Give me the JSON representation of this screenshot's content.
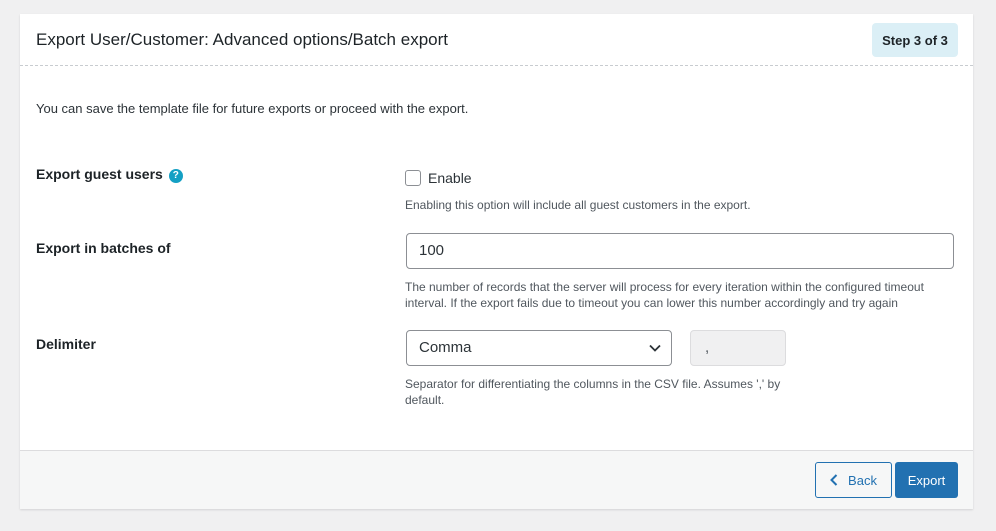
{
  "header": {
    "title": "Export User/Customer: Advanced options/Batch export",
    "step_badge": "Step 3 of 3"
  },
  "intro": "You can save the template file for future exports or proceed with the export.",
  "guest_users": {
    "label": "Export guest users",
    "help_icon": "question-circle-icon",
    "checkbox_label": "Enable",
    "checked": false,
    "description": "Enabling this option will include all guest customers in the export."
  },
  "batches": {
    "label": "Export in batches of",
    "value": "100",
    "description_line1": "The number of records that the server will process for every iteration within the configured timeout",
    "description_line2": "interval. If the export fails due to timeout you can lower this number accordingly and try again"
  },
  "delimiter": {
    "label": "Delimiter",
    "selected": "Comma",
    "value": ",",
    "description_line1": "Separator for differentiating the columns in the CSV file. Assumes ',' by",
    "description_line2": "default."
  },
  "footer": {
    "back_label": "Back",
    "export_label": "Export"
  },
  "colors": {
    "primary": "#2271b1",
    "badge_bg": "#dbeff6",
    "help_icon": "#14a0c4"
  }
}
